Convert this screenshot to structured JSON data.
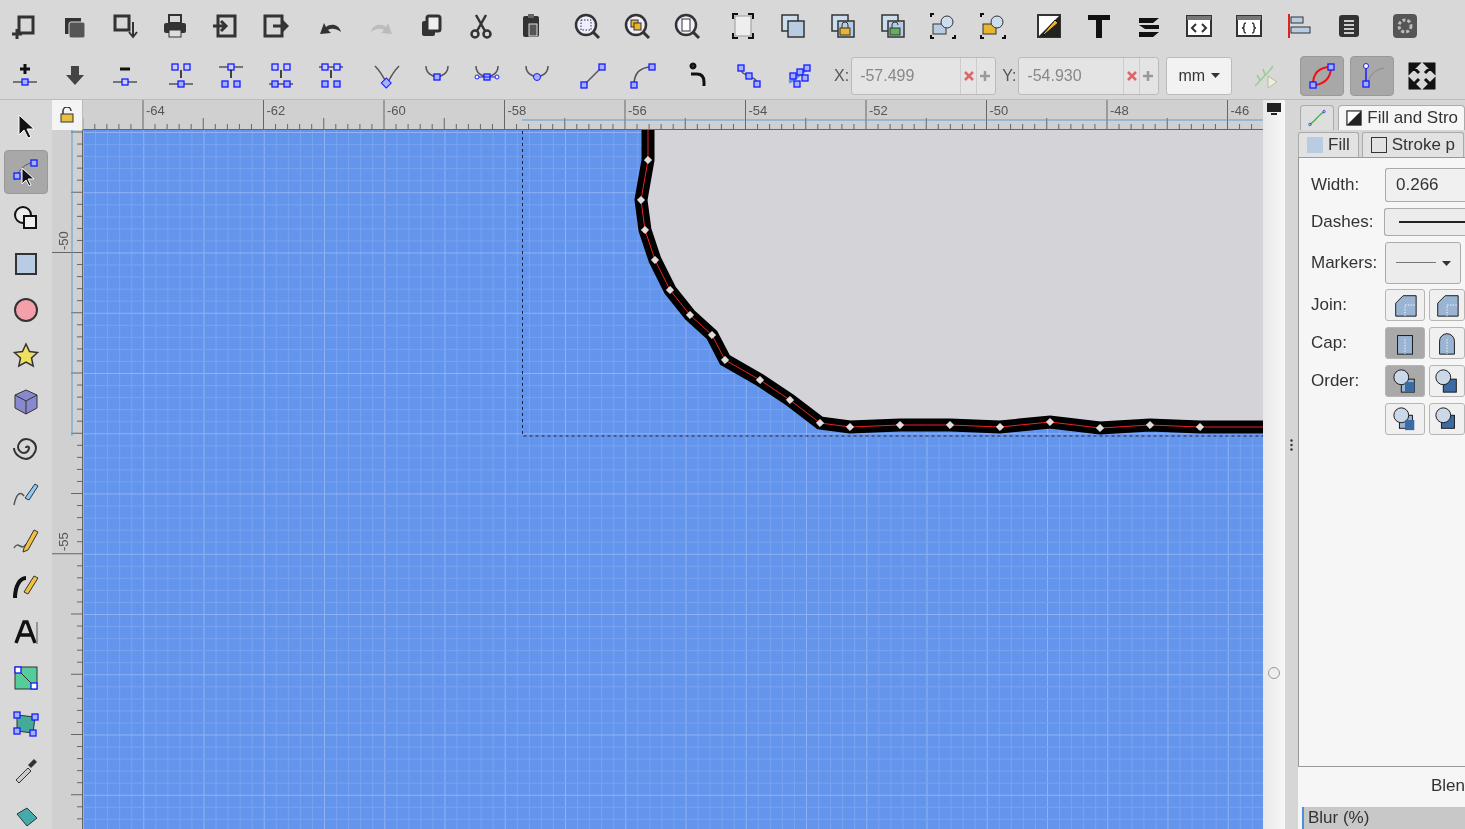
{
  "toolbar": {
    "x_label": "X:",
    "x_value": "-57.499",
    "y_label": "Y:",
    "y_value": "-54.930",
    "unit": "mm",
    "toggles": [
      {
        "on": true
      },
      {
        "on": true
      }
    ]
  },
  "tools": [
    {
      "selected": false
    },
    {
      "selected": true
    },
    {
      "selected": false
    },
    {
      "selected": false
    },
    {
      "selected": false
    },
    {
      "selected": false
    },
    {
      "selected": false
    },
    {
      "selected": false
    },
    {
      "selected": false
    },
    {
      "selected": false
    },
    {
      "selected": false
    },
    {
      "selected": false
    },
    {
      "selected": false
    },
    {
      "selected": false
    },
    {
      "selected": false
    },
    {
      "selected": false
    }
  ],
  "rulers": {
    "horizontal": [
      "-64",
      "-62",
      "-60",
      "-58",
      "-56",
      "-54",
      "-52",
      "-50",
      "-48",
      "-46"
    ],
    "vertical": [
      "-50",
      "-55"
    ]
  },
  "panel": {
    "tabs": [
      {
        "kind": "icon",
        "selected": false
      },
      {
        "kind": "text",
        "label": "Fill and Stro",
        "selected": true
      }
    ],
    "subtabs": [
      {
        "kind": "fill",
        "label": "Fill",
        "selected": false
      },
      {
        "kind": "stroke",
        "label": "Stroke p",
        "selected": false
      }
    ],
    "width": {
      "label": "Width:",
      "value": "0.266"
    },
    "dashes": {
      "label": "Dashes:"
    },
    "markers": {
      "label": "Markers:"
    },
    "join": {
      "label": "Join:",
      "options": [
        {
          "selected": false
        },
        {
          "selected": false
        }
      ]
    },
    "cap": {
      "label": "Cap:",
      "options": [
        {
          "selected": true
        },
        {
          "selected": false
        }
      ]
    },
    "order": {
      "label": "Order:",
      "options": [
        {
          "selected": true
        },
        {
          "selected": false
        },
        {
          "selected": false
        },
        {
          "selected": false
        }
      ]
    },
    "blend_label": "Blen",
    "blur_label": "Blur (%)"
  }
}
